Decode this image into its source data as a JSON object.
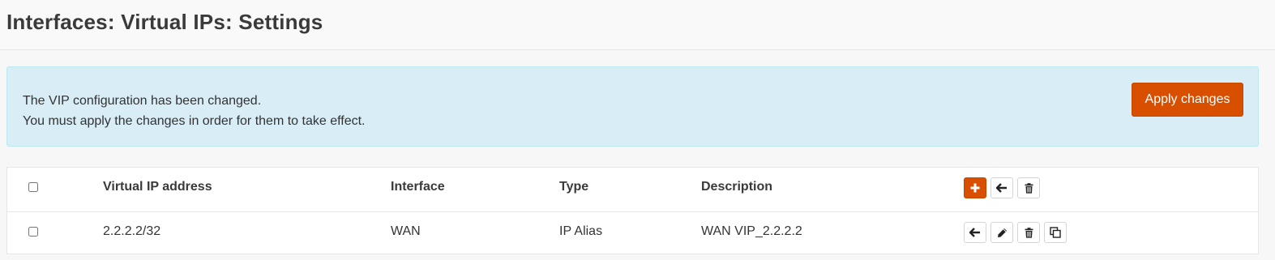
{
  "header": {
    "title": "Interfaces: Virtual IPs: Settings"
  },
  "alert": {
    "line1": "The VIP configuration has been changed.",
    "line2": "You must apply the changes in order for them to take effect.",
    "apply_label": "Apply changes"
  },
  "table": {
    "columns": {
      "virtual_ip": "Virtual IP address",
      "interface": "Interface",
      "type": "Type",
      "description": "Description"
    },
    "header_actions": [
      "plus-icon",
      "arrow-left-icon",
      "trash-icon"
    ],
    "rows": [
      {
        "virtual_ip": "2.2.2.2/32",
        "interface": "WAN",
        "type": "IP Alias",
        "description": "WAN VIP_2.2.2.2",
        "actions": [
          "arrow-left-icon",
          "pencil-icon",
          "trash-icon",
          "copy-icon"
        ]
      }
    ]
  },
  "colors": {
    "accent": "#d94f00",
    "alert_bg": "#d9edf7",
    "alert_border": "#bce8f1"
  }
}
